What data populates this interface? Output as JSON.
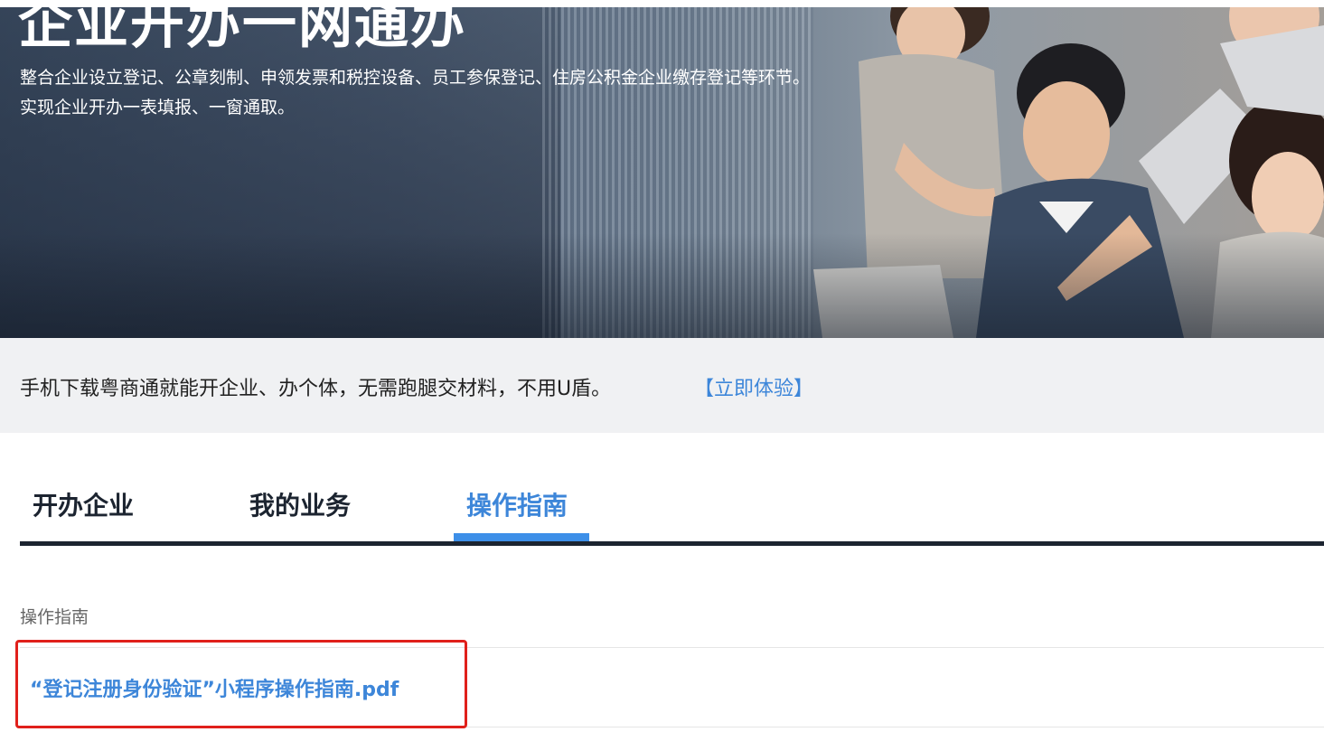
{
  "banner": {
    "title": "企业开办一网通办",
    "desc_line1": "整合企业设立登记、公章刻制、申领发票和税控设备、员工参保登记、住房公积金企业缴存登记等环节。",
    "desc_line2": "实现企业开办一表填报、一窗通取。"
  },
  "promo": {
    "text": "手机下载粤商通就能开企业、办个体，无需跑腿交材料，不用U盾。",
    "link": "【立即体验】"
  },
  "tabs": [
    {
      "label": "开办企业",
      "active": false
    },
    {
      "label": "我的业务",
      "active": false
    },
    {
      "label": "操作指南",
      "active": true
    }
  ],
  "guide": {
    "section_label": "操作指南",
    "documents": [
      {
        "title": "“登记注册身份验证”小程序操作指南.pdf"
      }
    ]
  },
  "colors": {
    "accent": "#3d86d9",
    "tab_underline": "#3d8fe8",
    "tab_bar": "#1c2430",
    "highlight": "#e0201b",
    "promo_bg": "#f0f1f3"
  }
}
